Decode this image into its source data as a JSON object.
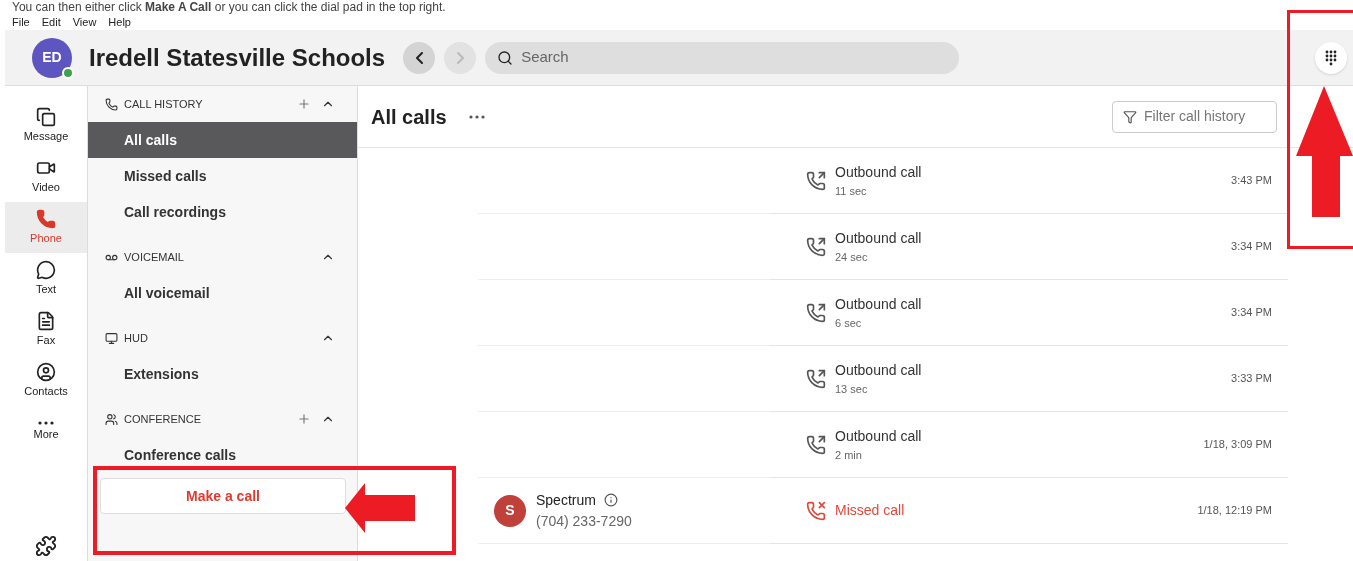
{
  "instruction": "You can then either click **Make A Call** or you can click the dial pad in the top right.",
  "menu": [
    "File",
    "Edit",
    "View",
    "Help"
  ],
  "header": {
    "avatar_initials": "ED",
    "online": true,
    "title": "Iredell Statesville Schools",
    "back_disabled": false,
    "forward_disabled": true,
    "search_placeholder": "Search"
  },
  "rail": [
    {
      "kind": "message",
      "label": "Message",
      "selected": false
    },
    {
      "kind": "video",
      "label": "Video",
      "selected": false
    },
    {
      "kind": "phone",
      "label": "Phone",
      "selected": true
    },
    {
      "kind": "text",
      "label": "Text",
      "selected": false
    },
    {
      "kind": "fax",
      "label": "Fax",
      "selected": false
    },
    {
      "kind": "contacts",
      "label": "Contacts",
      "selected": false
    },
    {
      "kind": "more",
      "label": "More",
      "selected": false
    }
  ],
  "nav": [
    {
      "kind": "history",
      "title": "CALL HISTORY",
      "addable": true,
      "expanded": true,
      "items": [
        {
          "label": "All calls",
          "selected": true
        },
        {
          "label": "Missed calls",
          "selected": false
        },
        {
          "label": "Call recordings",
          "selected": false
        }
      ]
    },
    {
      "kind": "voicemail",
      "title": "VOICEMAIL",
      "addable": false,
      "expanded": true,
      "items": [
        {
          "label": "All voicemail",
          "selected": false
        }
      ]
    },
    {
      "kind": "hud",
      "title": "HUD",
      "addable": false,
      "expanded": true,
      "items": [
        {
          "label": "Extensions",
          "selected": false
        }
      ]
    },
    {
      "kind": "conference",
      "title": "CONFERENCE",
      "addable": true,
      "expanded": true,
      "items": [
        {
          "label": "Conference calls",
          "selected": false
        }
      ]
    }
  ],
  "make_call_button": "Make a call",
  "main": {
    "title": "All calls",
    "filter_placeholder": "Filter call history"
  },
  "calls": [
    {
      "kind": "outbound",
      "label": "Outbound call",
      "duration": "11 sec",
      "time": "3:43 PM"
    },
    {
      "kind": "outbound",
      "label": "Outbound call",
      "duration": "24 sec",
      "time": "3:34 PM"
    },
    {
      "kind": "outbound",
      "label": "Outbound call",
      "duration": "6 sec",
      "time": "3:34 PM"
    },
    {
      "kind": "outbound",
      "label": "Outbound call",
      "duration": "13 sec",
      "time": "3:33 PM"
    },
    {
      "kind": "outbound",
      "label": "Outbound call",
      "duration": "2 min",
      "time": "1/18, 3:09 PM"
    },
    {
      "kind": "missed",
      "label": "Missed call",
      "contact": {
        "initials": "S",
        "name": "Spectrum",
        "number": "(704) 233-7290"
      },
      "time": "1/18, 12:19 PM"
    }
  ]
}
